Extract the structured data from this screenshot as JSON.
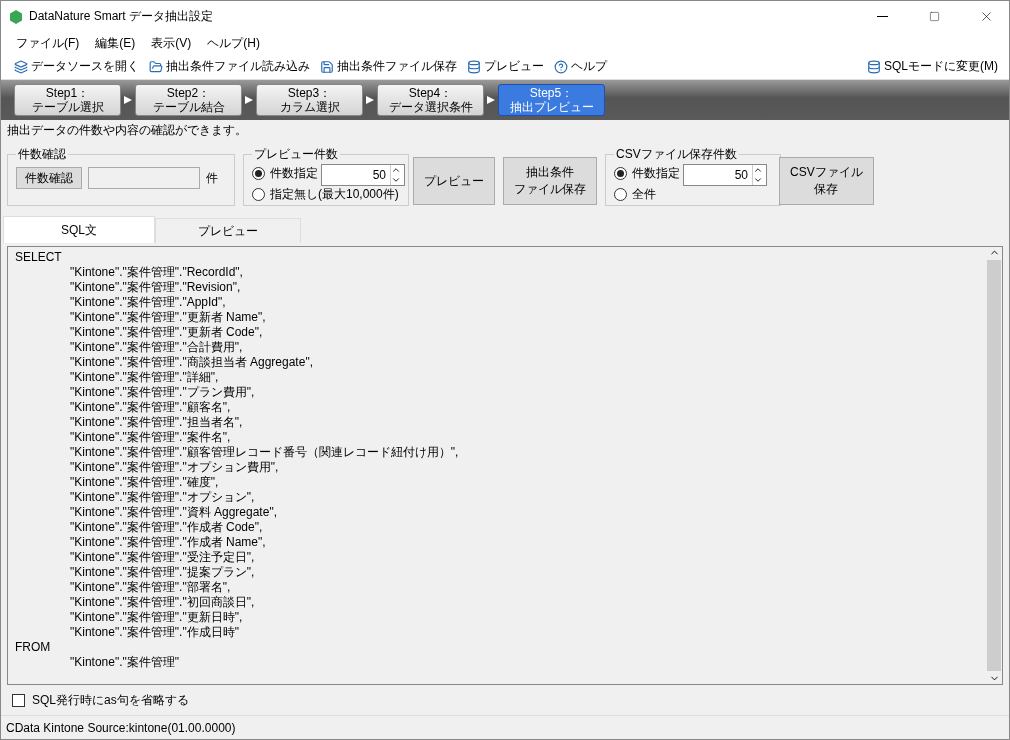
{
  "window": {
    "title": "DataNature Smart データ抽出設定"
  },
  "menu": [
    "ファイル(F)",
    "編集(E)",
    "表示(V)",
    "ヘルプ(H)"
  ],
  "toolbar": {
    "items": [
      {
        "kind": "datasource",
        "label": "データソースを開く"
      },
      {
        "kind": "open",
        "label": "抽出条件ファイル読み込み"
      },
      {
        "kind": "save",
        "label": "抽出条件ファイル保存"
      },
      {
        "kind": "preview",
        "label": "プレビュー"
      },
      {
        "kind": "help",
        "label": "ヘルプ"
      }
    ],
    "right": {
      "kind": "sql",
      "label": "SQLモードに変更(M)"
    }
  },
  "steps": [
    {
      "title": "Step1：",
      "subtitle": "テーブル選択",
      "selected": false
    },
    {
      "title": "Step2：",
      "subtitle": "テーブル結合",
      "selected": false
    },
    {
      "title": "Step3：",
      "subtitle": "カラム選択",
      "selected": false
    },
    {
      "title": "Step4：",
      "subtitle": "データ選択条件",
      "selected": false
    },
    {
      "title": "Step5：",
      "subtitle": "抽出プレビュー",
      "selected": true
    }
  ],
  "description": "抽出データの件数や内容の確認ができます。",
  "count_check": {
    "title": "件数確認",
    "button": "件数確認",
    "unit": "件"
  },
  "preview_count": {
    "title": "プレビュー件数",
    "options": [
      {
        "label": "件数指定",
        "selected": true
      },
      {
        "label": "指定無し(最大10,000件)",
        "selected": false
      }
    ],
    "value": "50"
  },
  "preview_button": "プレビュー",
  "save_button": [
    "抽出条件",
    "ファイル保存"
  ],
  "csv_count": {
    "title": "CSVファイル保存件数",
    "options": [
      {
        "label": "件数指定",
        "selected": true
      },
      {
        "label": "全件",
        "selected": false
      }
    ],
    "value": "50"
  },
  "csv_button": [
    "CSVファイル",
    "保存"
  ],
  "tabs": [
    {
      "label": "SQL文",
      "selected": true
    },
    {
      "label": "プレビュー",
      "selected": false
    }
  ],
  "sql": [
    {
      "kind": "keyword",
      "text": "SELECT"
    },
    {
      "kind": "item",
      "text": "\"Kintone\".\"案件管理\".\"RecordId\","
    },
    {
      "kind": "item",
      "text": "\"Kintone\".\"案件管理\".\"Revision\","
    },
    {
      "kind": "item",
      "text": "\"Kintone\".\"案件管理\".\"AppId\","
    },
    {
      "kind": "item",
      "text": "\"Kintone\".\"案件管理\".\"更新者 Name\","
    },
    {
      "kind": "item",
      "text": "\"Kintone\".\"案件管理\".\"更新者 Code\","
    },
    {
      "kind": "item",
      "text": "\"Kintone\".\"案件管理\".\"合計費用\","
    },
    {
      "kind": "item",
      "text": "\"Kintone\".\"案件管理\".\"商談担当者 Aggregate\","
    },
    {
      "kind": "item",
      "text": "\"Kintone\".\"案件管理\".\"詳細\","
    },
    {
      "kind": "item",
      "text": "\"Kintone\".\"案件管理\".\"プラン費用\","
    },
    {
      "kind": "item",
      "text": "\"Kintone\".\"案件管理\".\"顧客名\","
    },
    {
      "kind": "item",
      "text": "\"Kintone\".\"案件管理\".\"担当者名\","
    },
    {
      "kind": "item",
      "text": "\"Kintone\".\"案件管理\".\"案件名\","
    },
    {
      "kind": "item",
      "text": "\"Kintone\".\"案件管理\".\"顧客管理レコード番号（関連レコード紐付け用）\","
    },
    {
      "kind": "item",
      "text": "\"Kintone\".\"案件管理\".\"オプション費用\","
    },
    {
      "kind": "item",
      "text": "\"Kintone\".\"案件管理\".\"確度\","
    },
    {
      "kind": "item",
      "text": "\"Kintone\".\"案件管理\".\"オプション\","
    },
    {
      "kind": "item",
      "text": "\"Kintone\".\"案件管理\".\"資料 Aggregate\","
    },
    {
      "kind": "item",
      "text": "\"Kintone\".\"案件管理\".\"作成者 Code\","
    },
    {
      "kind": "item",
      "text": "\"Kintone\".\"案件管理\".\"作成者 Name\","
    },
    {
      "kind": "item",
      "text": "\"Kintone\".\"案件管理\".\"受注予定日\","
    },
    {
      "kind": "item",
      "text": "\"Kintone\".\"案件管理\".\"提案プラン\","
    },
    {
      "kind": "item",
      "text": "\"Kintone\".\"案件管理\".\"部署名\","
    },
    {
      "kind": "item",
      "text": "\"Kintone\".\"案件管理\".\"初回商談日\","
    },
    {
      "kind": "item",
      "text": "\"Kintone\".\"案件管理\".\"更新日時\","
    },
    {
      "kind": "item",
      "text": "\"Kintone\".\"案件管理\".\"作成日時\""
    },
    {
      "kind": "keyword",
      "text": "FROM"
    },
    {
      "kind": "item",
      "text": "\"Kintone\".\"案件管理\""
    }
  ],
  "omit_as": {
    "label": "SQL発行時にas句を省略する",
    "checked": false
  },
  "status": "CData Kintone Source:kintone(01.00.0000)"
}
